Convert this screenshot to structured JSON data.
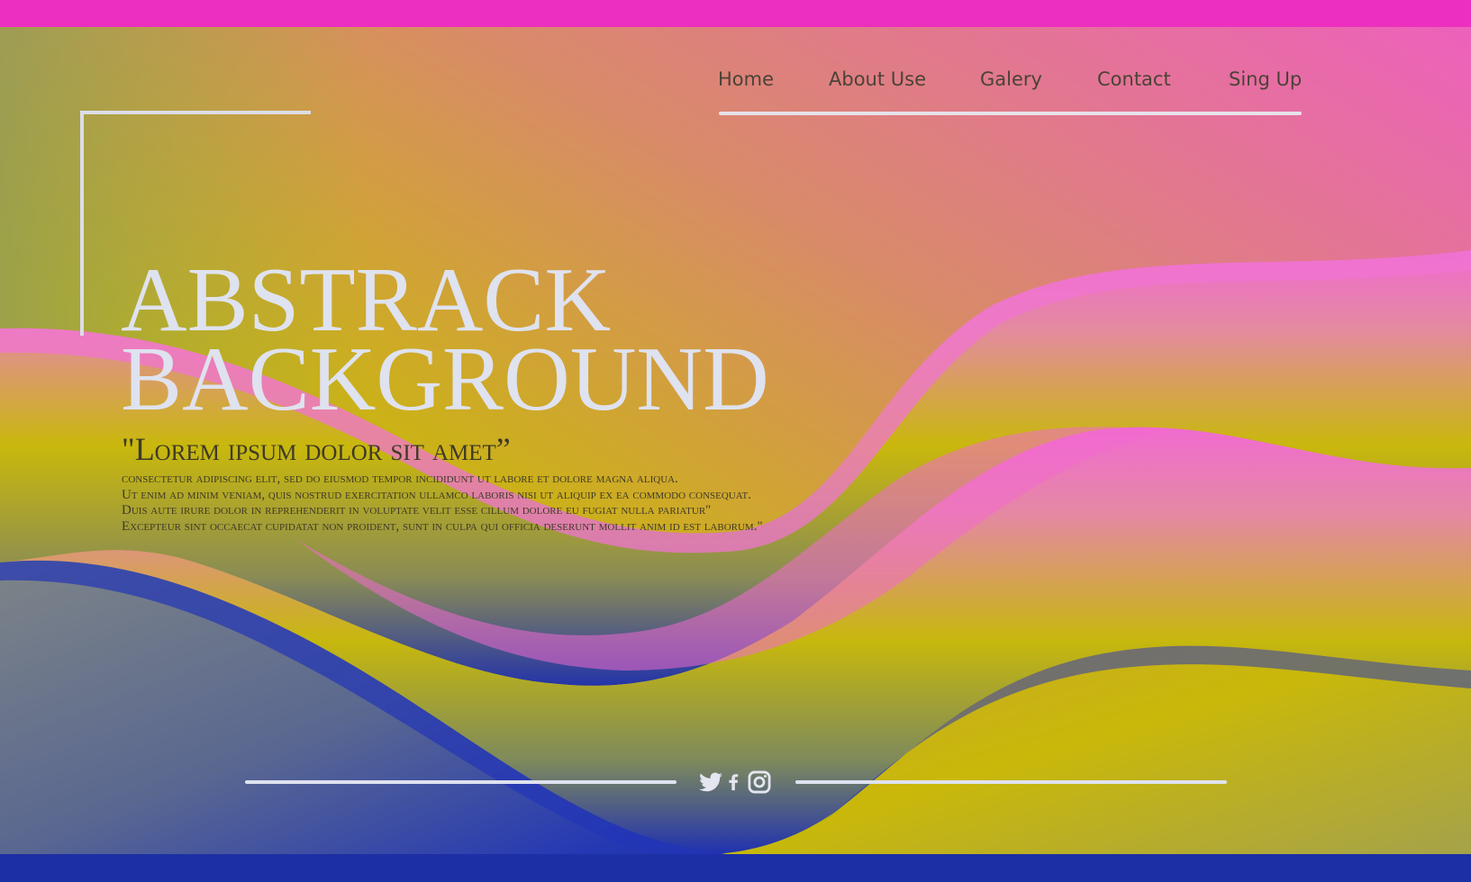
{
  "nav": {
    "items": [
      {
        "label": "Home"
      },
      {
        "label": "About Use"
      },
      {
        "label": "Galery"
      },
      {
        "label": "Contact"
      },
      {
        "label": "Sing Up"
      }
    ]
  },
  "hero": {
    "title_line1": "ABSTRACK",
    "title_line2": "BACKGROUND",
    "quote": "\"Lorem ipsum dolor sit amet”",
    "body_lines": [
      "consectetur adipiscing elit, sed do eiusmod tempor incididunt ut labore et dolore magna aliqua.",
      "Ut enim ad minim veniam, quis nostrud exercitation ullamco laboris nisi ut aliquip ex ea commodo consequat.",
      "Duis aute irure dolor in reprehenderit in voluptate velit esse cillum dolore eu fugiat nulla pariatur\"",
      "Excepteur sint occaecat cupidatat non proident, sunt in culpa qui officia deserunt mollit anim id est laborum.\""
    ]
  },
  "social": {
    "icons": [
      "twitter-icon",
      "facebook-icon",
      "instagram-icon"
    ]
  },
  "colors": {
    "top_bar": "#ec2fbf",
    "bottom_bar": "#1d2fa4",
    "yellow": "#c8bb05",
    "pink": "#f06ccd",
    "blue": "#1f2fb0",
    "text_light": "#dfe2ef",
    "text_dark": "#3e3a26"
  }
}
